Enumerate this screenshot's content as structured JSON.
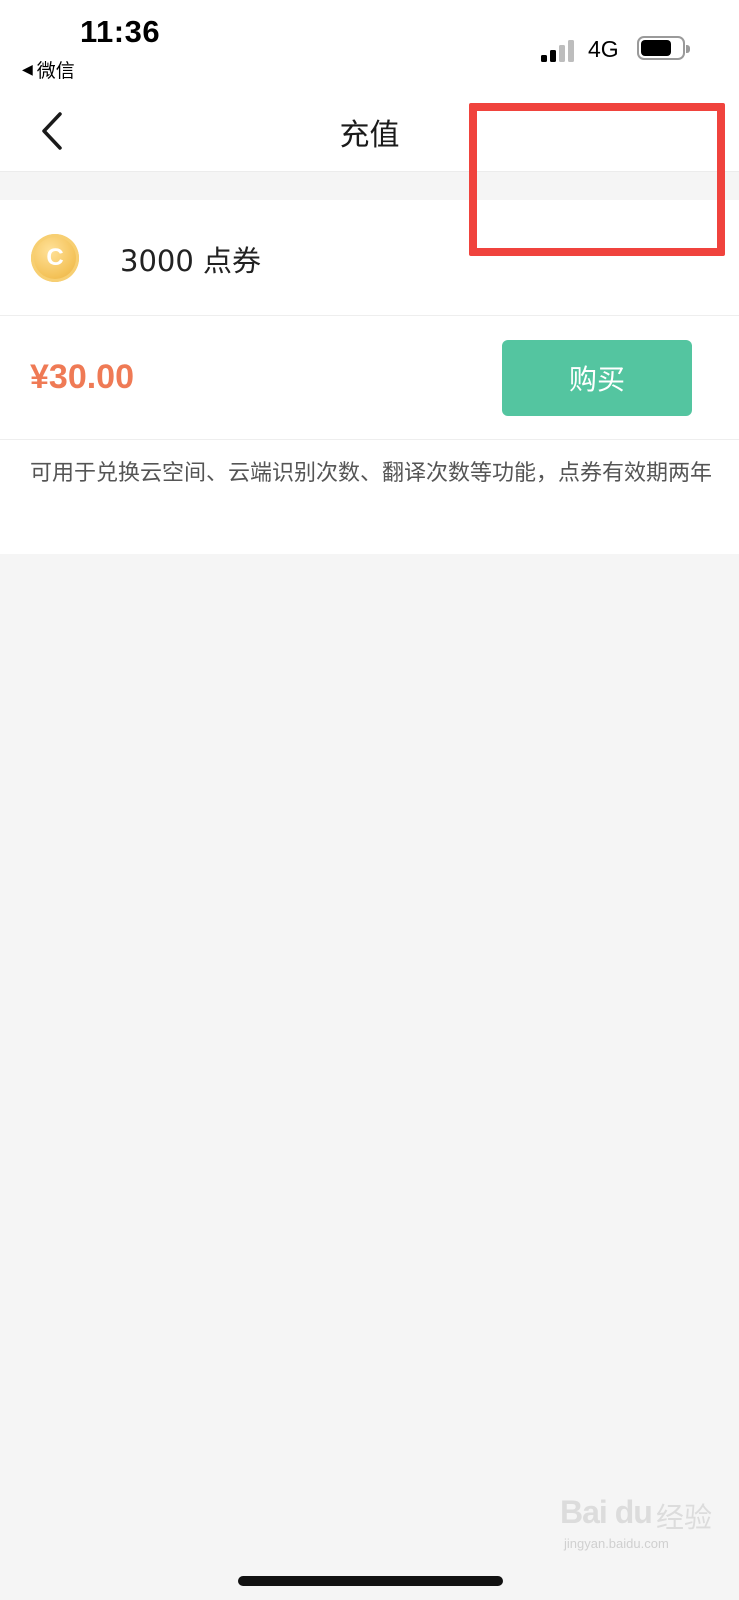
{
  "status_bar": {
    "time": "11:36",
    "back_app": "微信",
    "back_icon": "back-triangle-icon",
    "network": "4G",
    "signal_icon": "signal-bars-icon",
    "battery_icon": "battery-icon",
    "battery_level": 0.75
  },
  "nav": {
    "back_icon": "chevron-left-icon",
    "title": "充值"
  },
  "product": {
    "icon": "coin-icon",
    "icon_letter": "C",
    "name": "3000 点券",
    "price": "¥30.00",
    "buy_label": "购买",
    "description": "可用于兑换云空间、云端识别次数、翻译次数等功能，点券有效期两年"
  },
  "watermark": {
    "main": "Bai du",
    "cn": "经验",
    "url": "jingyan.baidu.com"
  },
  "colors": {
    "accent_green": "#54c5a0",
    "price_orange": "#ef7a55",
    "highlight_red": "#f0433d",
    "coin_gold": "#f4c35a"
  }
}
